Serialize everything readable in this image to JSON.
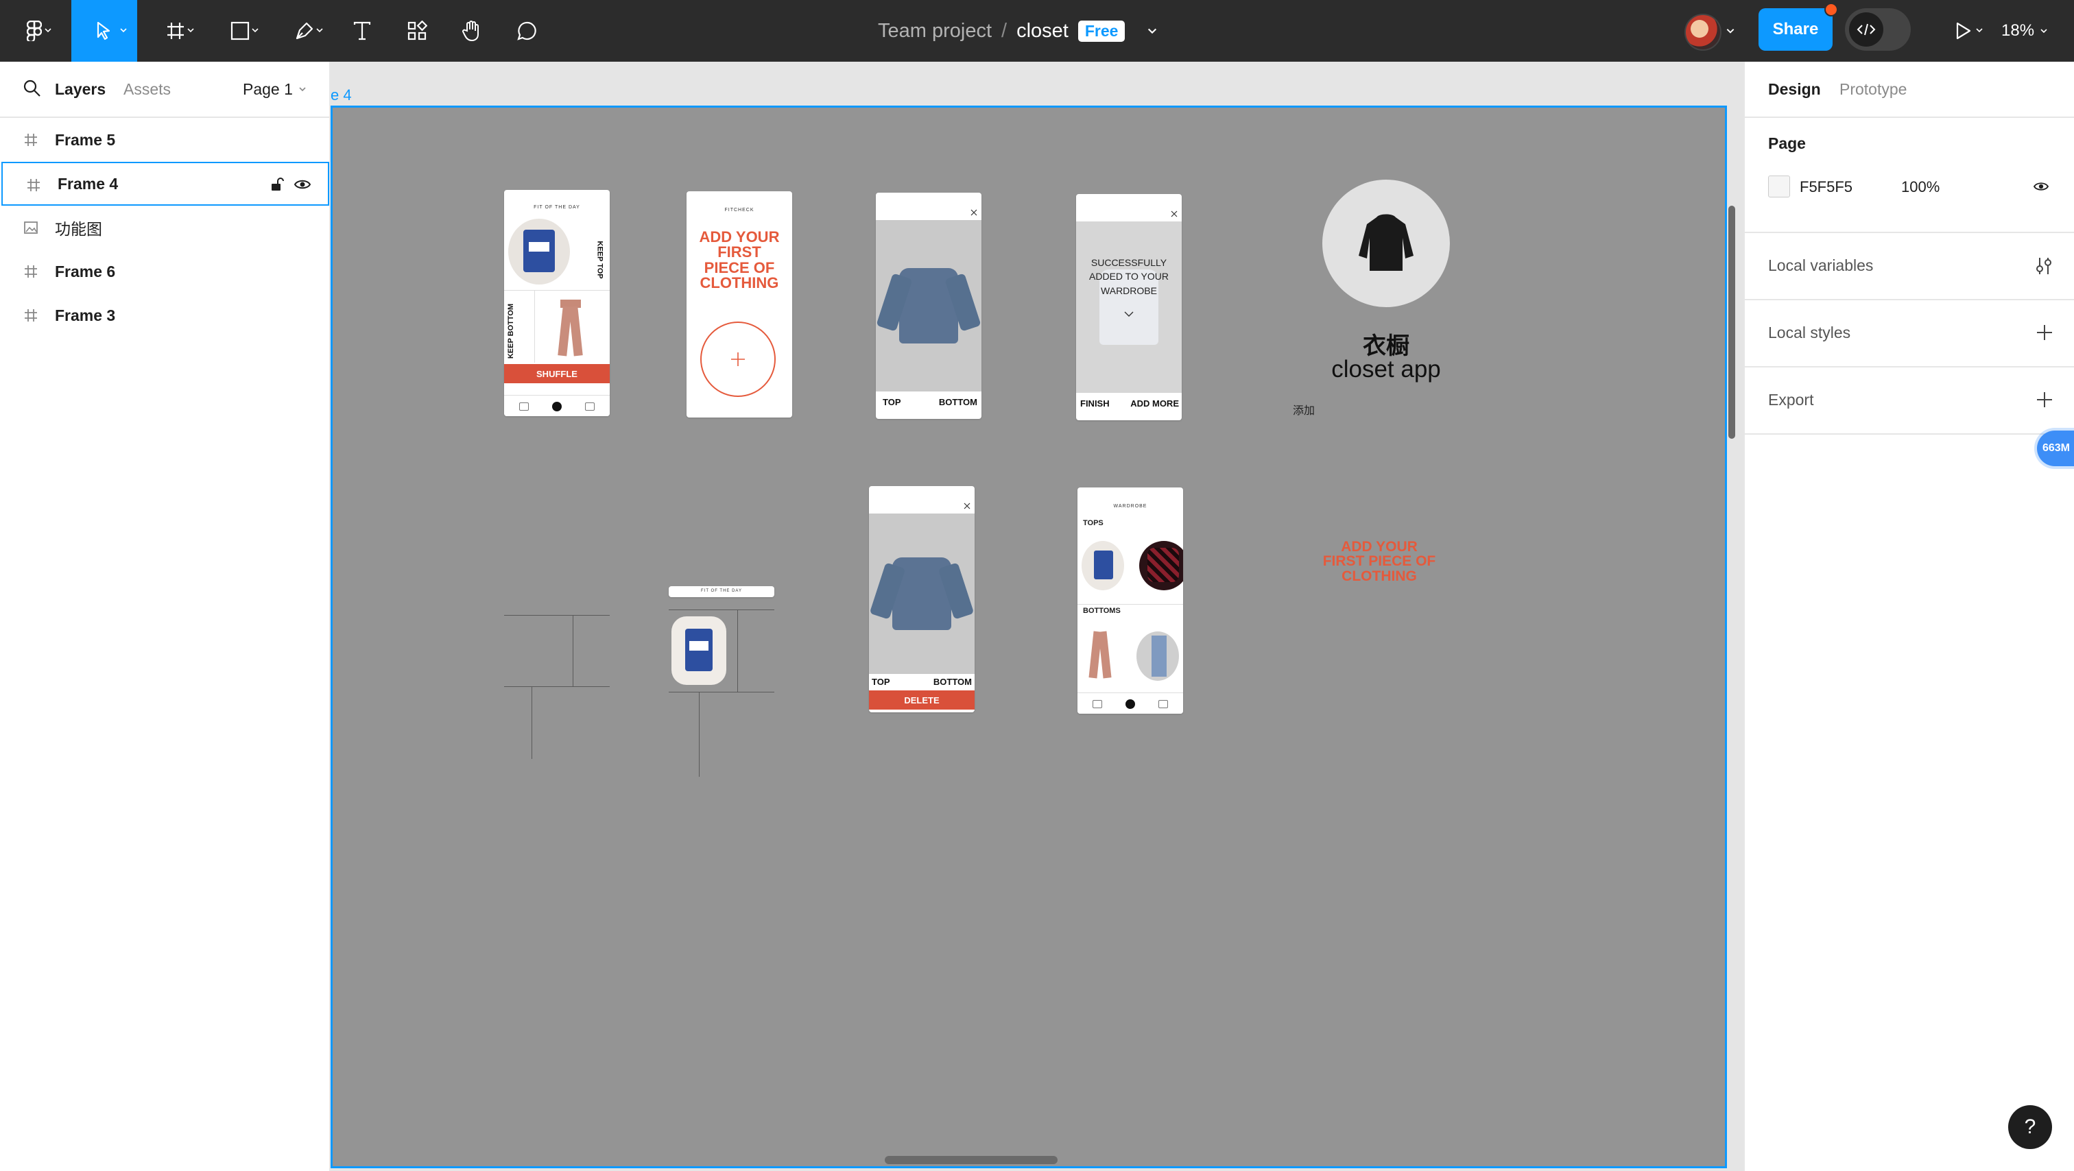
{
  "toolbar": {
    "breadcrumb_team": "Team project",
    "breadcrumb_sep": "/",
    "file_name": "closet",
    "plan_badge": "Free",
    "share_label": "Share",
    "zoom": "18%"
  },
  "left_panel": {
    "tabs": [
      "Layers",
      "Assets"
    ],
    "page_selector": "Page 1",
    "layers": [
      {
        "label": "Frame 5",
        "icon": "frame-icon"
      },
      {
        "label": "Frame 4",
        "icon": "frame-icon",
        "selected": true
      },
      {
        "label": "功能图",
        "icon": "image-icon"
      },
      {
        "label": "Frame 6",
        "icon": "frame-icon"
      },
      {
        "label": "Frame 3",
        "icon": "frame-icon"
      }
    ]
  },
  "canvas": {
    "frame_label": "e 4",
    "screens": {
      "outfit_title": "FIT OF THE DAY",
      "keep_top": "KEEP TOP",
      "keep_bottom": "KEEP BOTTOM",
      "shuffle": "SHUFFLE",
      "fitcheck_title": "FITCHECK",
      "add_first": "ADD YOUR FIRST PIECE OF CLOTHING",
      "top": "TOP",
      "bottom": "BOTTOM",
      "success": "SUCCESSFULLY ADDED TO YOUR WARDROBE",
      "finish": "FINISH",
      "add_more": "ADD MORE",
      "delete": "DELETE",
      "wardrobe_title": "WARDROBE",
      "tops": "TOPS",
      "bottoms": "BOTTOMS"
    },
    "app_title_cn": "衣橱",
    "app_title_en": "closet app",
    "add_label_cn": "添加",
    "loose_text": "ADD YOUR FIRST PIECE OF CLOTHING",
    "brand_orange": "#e55a3c",
    "board_color": "#949494"
  },
  "right_panel": {
    "tabs": [
      "Design",
      "Prototype"
    ],
    "page_heading": "Page",
    "page_color": "F5F5F5",
    "page_opacity": "100%",
    "local_variables": "Local variables",
    "local_styles": "Local styles",
    "export": "Export",
    "memory_badge": "663M",
    "help": "?"
  },
  "colors": {
    "accent": "#0d99ff",
    "toolbar_bg": "#2c2c2c"
  }
}
